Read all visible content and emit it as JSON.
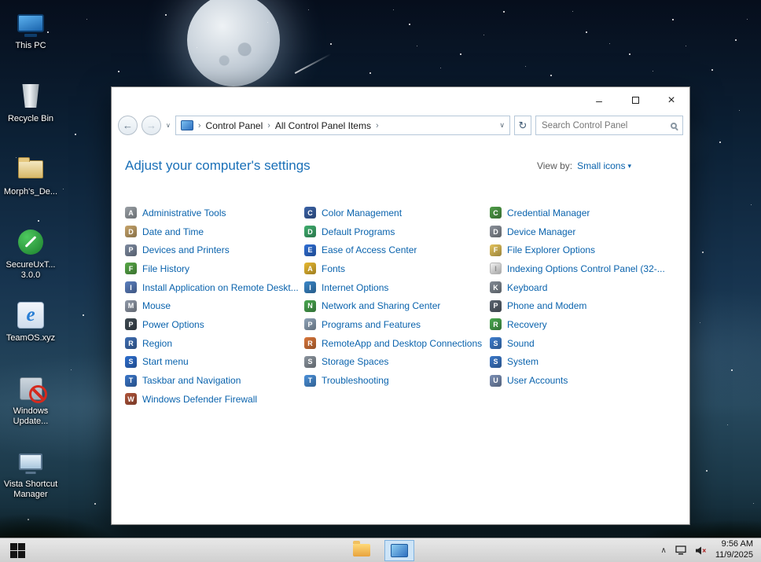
{
  "desktop": {
    "icons": [
      {
        "kind": "this-pc",
        "label": "This PC"
      },
      {
        "kind": "recycle-bin",
        "label": "Recycle Bin"
      },
      {
        "kind": "folder",
        "label": "Morph's_De..."
      },
      {
        "kind": "secureux",
        "label": "SecureUxT...\n3.0.0"
      },
      {
        "kind": "ie",
        "label": "TeamOS.xyz"
      },
      {
        "kind": "windows-update",
        "label": "Windows\nUpdate..."
      },
      {
        "kind": "vista-monitor",
        "label": "Vista Shortcut\nManager"
      }
    ]
  },
  "window": {
    "controls": {
      "minimize": "–",
      "close": "×"
    },
    "nav": {
      "back_icon": "←",
      "forward_icon": "→",
      "dropdown_icon": "∨",
      "refresh_icon": "↻",
      "separator": "›",
      "breadcrumb": [
        "Control Panel",
        "All Control Panel Items"
      ],
      "search_placeholder": "Search Control Panel"
    },
    "header": {
      "title": "Adjust your computer's settings",
      "view_by_label": "View by:",
      "view_by_value": "Small icons",
      "view_by_caret": "▾"
    },
    "columns": [
      [
        {
          "label": "Administrative Tools",
          "color": "#9aa0a6",
          "glyph": "A"
        },
        {
          "label": "Date and Time",
          "color": "#c7a46a",
          "glyph": "D"
        },
        {
          "label": "Devices and Printers",
          "color": "#7d8aa0",
          "glyph": "P"
        },
        {
          "label": "File History",
          "color": "#57a846",
          "glyph": "F"
        },
        {
          "label": "Install Application on Remote Deskt...",
          "color": "#5b7fbf",
          "glyph": "I"
        },
        {
          "label": "Mouse",
          "color": "#9099a8",
          "glyph": "M"
        },
        {
          "label": "Power Options",
          "color": "#3f4a52",
          "glyph": "P"
        },
        {
          "label": "Region",
          "color": "#3f6fb5",
          "glyph": "R"
        },
        {
          "label": "Start menu",
          "color": "#2e6fd0",
          "glyph": "S"
        },
        {
          "label": "Taskbar and Navigation",
          "color": "#3a76c9",
          "glyph": "T"
        },
        {
          "label": "Windows Defender Firewall",
          "color": "#b0543a",
          "glyph": "W"
        }
      ],
      [
        {
          "label": "Color Management",
          "color": "#3b63a8",
          "glyph": "C"
        },
        {
          "label": "Default Programs",
          "color": "#3fae6e",
          "glyph": "D"
        },
        {
          "label": "Ease of Access Center",
          "color": "#2f6fd6",
          "glyph": "E"
        },
        {
          "label": "Fonts",
          "color": "#e8b931",
          "glyph": "A"
        },
        {
          "label": "Internet Options",
          "color": "#3a87c9",
          "glyph": "I"
        },
        {
          "label": "Network and Sharing Center",
          "color": "#49a64f",
          "glyph": "N"
        },
        {
          "label": "Programs and Features",
          "color": "#8fa3b8",
          "glyph": "P"
        },
        {
          "label": "RemoteApp and Desktop Connections",
          "color": "#d9763a",
          "glyph": "R"
        },
        {
          "label": "Storage Spaces",
          "color": "#8b949e",
          "glyph": "S"
        },
        {
          "label": "Troubleshooting",
          "color": "#4a90d9",
          "glyph": "T"
        }
      ],
      [
        {
          "label": "Credential Manager",
          "color": "#4f9d48",
          "glyph": "C"
        },
        {
          "label": "Device Manager",
          "color": "#8a9099",
          "glyph": "D"
        },
        {
          "label": "File Explorer Options",
          "color": "#e3c25a",
          "glyph": "F"
        },
        {
          "label": "Indexing Options Control Panel (32-...",
          "color": "#f2f2f2",
          "glyph": "I",
          "fg": "#8a8a8a",
          "border": true
        },
        {
          "label": "Keyboard",
          "color": "#828a94",
          "glyph": "K"
        },
        {
          "label": "Phone and Modem",
          "color": "#5a6470",
          "glyph": "P"
        },
        {
          "label": "Recovery",
          "color": "#49a84f",
          "glyph": "R"
        },
        {
          "label": "Sound",
          "color": "#3e7fd0",
          "glyph": "S"
        },
        {
          "label": "System",
          "color": "#3b78c9",
          "glyph": "S"
        },
        {
          "label": "User Accounts",
          "color": "#7a8fb5",
          "glyph": "U"
        }
      ]
    ]
  },
  "taskbar": {
    "tray_chevron": "∧",
    "time": "9:56 AM",
    "date": "11/9/2025"
  },
  "colors": {
    "link_blue": "#0a63ad",
    "header_blue": "#1a70b8"
  }
}
